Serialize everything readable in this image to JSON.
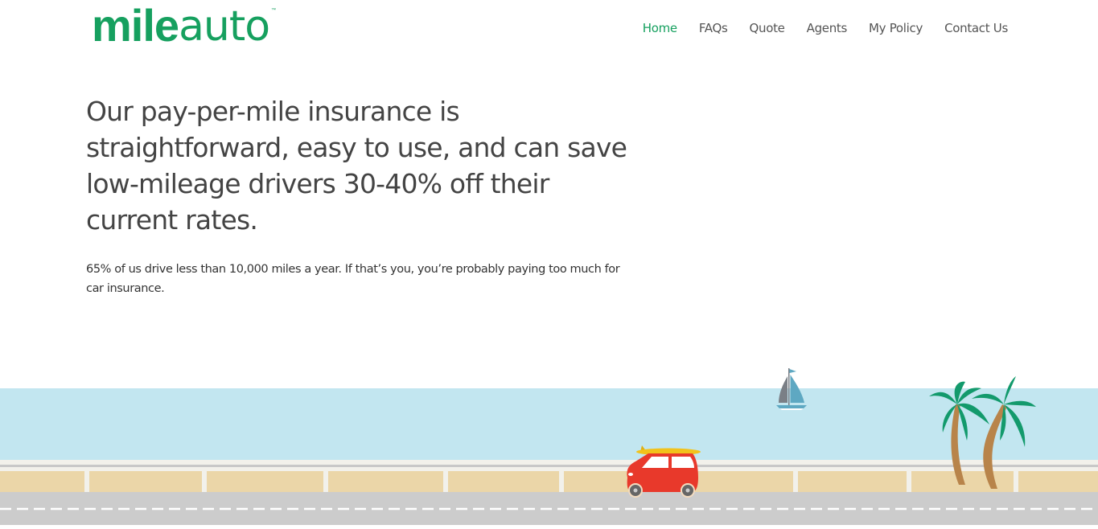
{
  "brand": {
    "logo_bold": "mile",
    "logo_light": "auto",
    "logo_tm": "™",
    "color": "#16a05f"
  },
  "nav": {
    "items": [
      {
        "label": "Home",
        "active": true
      },
      {
        "label": "FAQs",
        "active": false
      },
      {
        "label": "Quote",
        "active": false
      },
      {
        "label": "Agents",
        "active": false
      },
      {
        "label": "My Policy",
        "active": false
      },
      {
        "label": "Contact Us",
        "active": false
      }
    ]
  },
  "hero": {
    "title": "Our pay-per-mile insurance is straightforward, easy to use, and can save low-mileage drivers 30-40% off their current rates.",
    "subtitle": "65% of us drive less than 10,000 miles a year. If that’s you, you’re probably paying too much for car insurance."
  },
  "illustration": {
    "icons": [
      "sailboat-icon",
      "palm-tree-icon",
      "car-with-surfboard-icon"
    ],
    "colors": {
      "sky": "#c2e6f0",
      "sand": "#ebd6a8",
      "road": "#cccccc",
      "car": "#e8392b",
      "surfboard": "#f2c21b",
      "palm_leaf": "#139a6c",
      "palm_trunk": "#b8844a"
    }
  }
}
